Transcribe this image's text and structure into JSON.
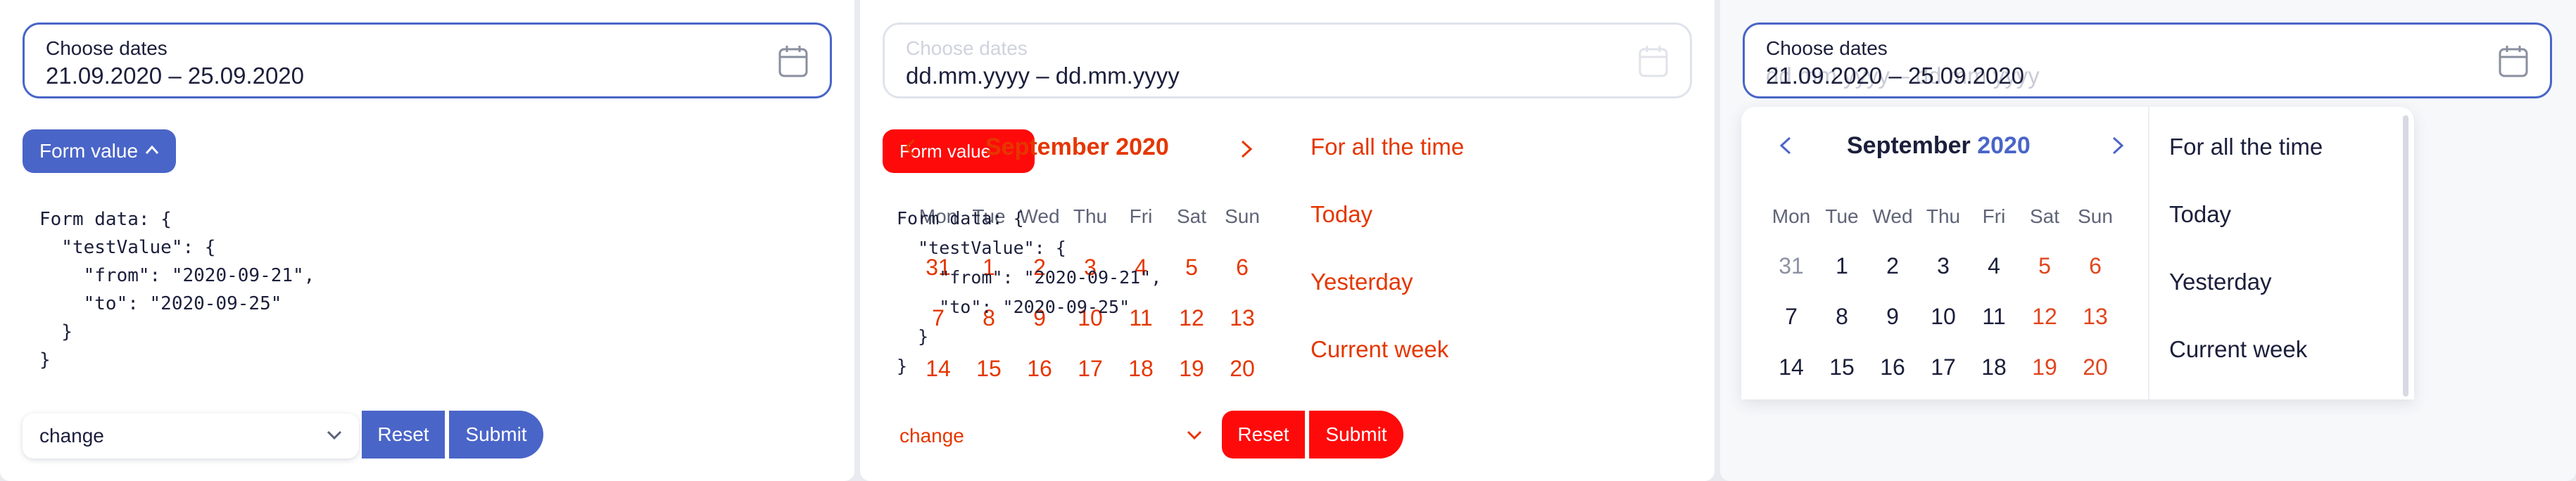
{
  "panels": [
    {
      "date_field": {
        "label": "Choose dates",
        "value": "21.09.2020 – 25.09.2020"
      },
      "form_button": "Form value",
      "form_data": "Form data: {\n  \"testValue\": {\n    \"from\": \"2020-09-21\",\n    \"to\": \"2020-09-25\"\n  }\n}",
      "select_value": "change",
      "reset": "Reset",
      "submit": "Submit"
    },
    {
      "date_field": {
        "label": "Choose dates",
        "value": "dd.mm.yyyy – dd.mm.yyyy"
      },
      "form_button": "Form value",
      "form_data": "Form data: {\n  \"testValue\": {\n    \"from\": \"2020-09-21\",\n    \"to\": \"2020-09-25\"\n  }\n}",
      "select_value": "change",
      "reset": "Reset",
      "submit": "Submit",
      "calendar": {
        "month": "September",
        "year": "2020",
        "weekdays": [
          "Mon",
          "Tue",
          "Wed",
          "Thu",
          "Fri",
          "Sat",
          "Sun"
        ],
        "rows": [
          [
            "31",
            "1",
            "2",
            "3",
            "4",
            "5",
            "6"
          ],
          [
            "7",
            "8",
            "9",
            "10",
            "11",
            "12",
            "13"
          ],
          [
            "14",
            "15",
            "16",
            "17",
            "18",
            "19",
            "20"
          ]
        ]
      },
      "presets": [
        "For all the time",
        "Today",
        "Yesterday",
        "Current week"
      ]
    },
    {
      "date_field": {
        "label": "Choose dates",
        "value": "21.09.2020 – 25.09.2020",
        "ghost_value": "dd.mm.yyyy – dd.mm.yyyy"
      },
      "calendar": {
        "month": "September",
        "year": "2020",
        "weekdays": [
          "Mon",
          "Tue",
          "Wed",
          "Thu",
          "Fri",
          "Sat",
          "Sun"
        ],
        "rows": [
          [
            "31",
            "1",
            "2",
            "3",
            "4",
            "5",
            "6"
          ],
          [
            "7",
            "8",
            "9",
            "10",
            "11",
            "12",
            "13"
          ],
          [
            "14",
            "15",
            "16",
            "17",
            "18",
            "19",
            "20"
          ]
        ]
      },
      "presets": [
        "For all the time",
        "Today",
        "Yesterday",
        "Current week"
      ]
    }
  ],
  "colors": {
    "accent": "#4a65c8",
    "weekend": "#e0461f",
    "diff_red": "#ff0a0a",
    "diff_text": "#e53600"
  },
  "icons": [
    "calendar-icon",
    "chevron-up-icon",
    "chevron-down-icon",
    "arrow-left-icon",
    "arrow-right-icon"
  ]
}
